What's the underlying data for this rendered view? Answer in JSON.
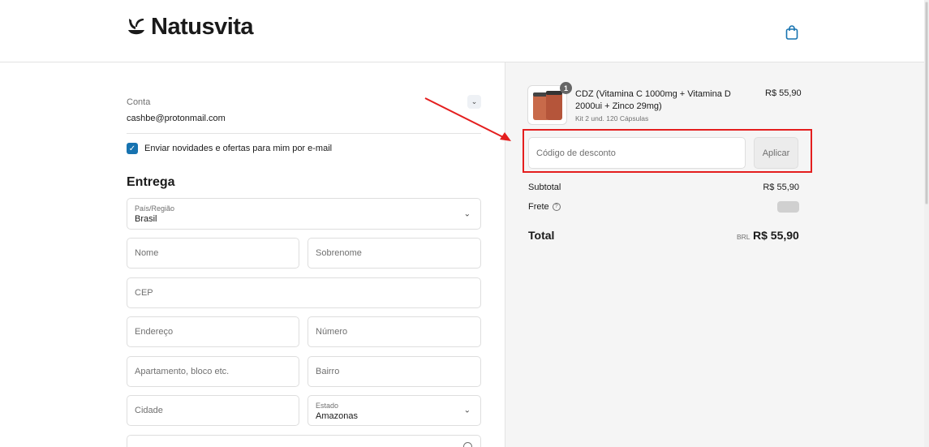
{
  "header": {
    "brand": "Natusvita",
    "cart_icon": "shopping-bag-icon"
  },
  "account": {
    "label": "Conta",
    "email": "cashbe@protonmail.com",
    "newsletter_label": "Enviar novidades e ofertas para mim por e-mail",
    "newsletter_checked": true
  },
  "delivery": {
    "title": "Entrega",
    "country_label": "País/Região",
    "country_value": "Brasil",
    "first_name_placeholder": "Nome",
    "last_name_placeholder": "Sobrenome",
    "zip_placeholder": "CEP",
    "address_placeholder": "Endereço",
    "number_placeholder": "Número",
    "apartment_placeholder": "Apartamento, bloco etc.",
    "district_placeholder": "Bairro",
    "city_placeholder": "Cidade",
    "state_label": "Estado",
    "state_value": "Amazonas"
  },
  "cart": {
    "item": {
      "quantity": "1",
      "name": "CDZ (Vitamina C 1000mg + Vitamina D 2000ui + Zinco 29mg)",
      "variant": "Kit 2 und. 120 Cápsulas",
      "price": "R$ 55,90"
    },
    "discount_placeholder": "Código de desconto",
    "apply_label": "Aplicar",
    "subtotal_label": "Subtotal",
    "subtotal_value": "R$ 55,90",
    "shipping_label": "Frete",
    "total_label": "Total",
    "total_currency": "BRL",
    "total_value": "R$ 55,90"
  },
  "colors": {
    "accent": "#1773b0",
    "highlight": "#e41e1e",
    "panel_bg": "#f5f5f5"
  }
}
